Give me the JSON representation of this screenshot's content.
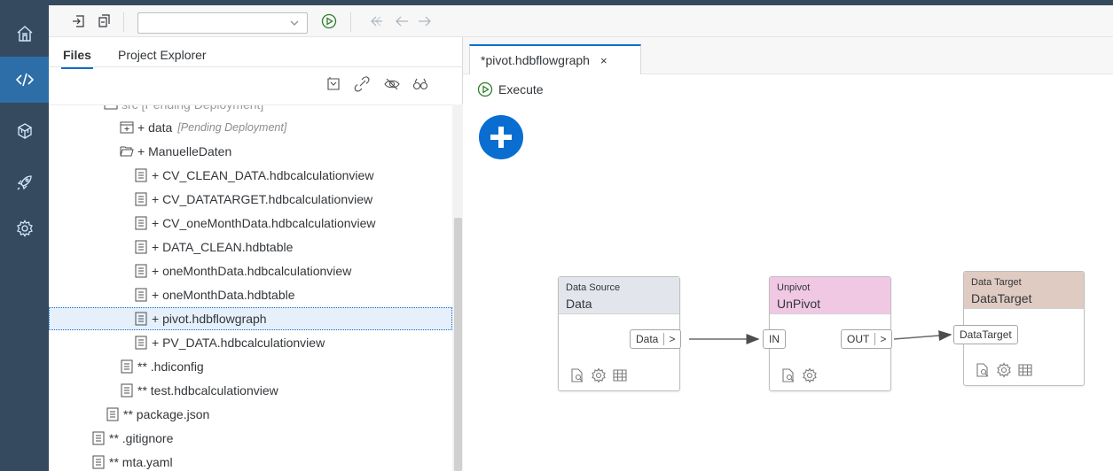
{
  "colors": {
    "rail_bg": "#354a5f",
    "accent": "#0a6ed1",
    "source_header": "#e2e6ec",
    "unpivot_header": "#f0c8e4",
    "target_header": "#e0cbc2"
  },
  "rail": {
    "items": [
      {
        "name": "home-icon",
        "active": false
      },
      {
        "name": "code-icon",
        "active": true
      },
      {
        "name": "package-icon",
        "active": false
      },
      {
        "name": "rocket-icon",
        "active": false
      },
      {
        "name": "settings-icon",
        "active": false
      }
    ]
  },
  "toolbar": {
    "run_config_selected": ""
  },
  "files_panel": {
    "tabs": [
      {
        "label": "Files",
        "active": true
      },
      {
        "label": "Project Explorer",
        "active": false
      }
    ]
  },
  "tree": {
    "rows": [
      {
        "label": "src  [Pending Deployment]",
        "type": "folder",
        "indent": 1
      },
      {
        "label": "+ data",
        "pending": "[Pending Deployment]",
        "type": "folder-add",
        "indent": 2
      },
      {
        "label": "+ ManuelleDaten",
        "type": "folder-open",
        "indent": 2
      },
      {
        "label": "+ CV_CLEAN_DATA.hdbcalculationview",
        "type": "file",
        "indent": 3
      },
      {
        "label": "+ CV_DATATARGET.hdbcalculationview",
        "type": "file",
        "indent": 3
      },
      {
        "label": "+ CV_oneMonthData.hdbcalculationview",
        "type": "file",
        "indent": 3
      },
      {
        "label": "+ DATA_CLEAN.hdbtable",
        "type": "file",
        "indent": 3
      },
      {
        "label": "+ oneMonthData.hdbcalculationview",
        "type": "file",
        "indent": 3
      },
      {
        "label": "+ oneMonthData.hdbtable",
        "type": "file",
        "indent": 3
      },
      {
        "label": "+ pivot.hdbflowgraph",
        "type": "file",
        "indent": 3,
        "selected": true
      },
      {
        "label": "+ PV_DATA.hdbcalculationview",
        "type": "file",
        "indent": 3
      },
      {
        "label": "** .hdiconfig",
        "type": "file",
        "indent": 2
      },
      {
        "label": "** test.hdbcalculationview",
        "type": "file",
        "indent": 2
      },
      {
        "label": "** package.json",
        "type": "file",
        "indent": 1
      },
      {
        "label": "** .gitignore",
        "type": "file",
        "indent": 0
      },
      {
        "label": "** mta.yaml",
        "type": "file",
        "indent": 0
      }
    ]
  },
  "editor": {
    "tab_label": "*pivot.hdbflowgraph",
    "close_label": "×",
    "execute_label": "Execute"
  },
  "flowgraph": {
    "nodes": [
      {
        "type": "Data Source",
        "name": "Data",
        "port_out": "Data",
        "icons": [
          "search-doc-icon",
          "settings-icon",
          "table-icon"
        ]
      },
      {
        "type": "Unpivot",
        "name": "UnPivot",
        "port_in": "IN",
        "port_out": "OUT",
        "icons": [
          "search-doc-icon",
          "settings-icon"
        ]
      },
      {
        "type": "Data Target",
        "name": "DataTarget",
        "port_in": "DataTarget",
        "icons": [
          "search-doc-icon",
          "settings-icon",
          "table-icon"
        ]
      }
    ]
  }
}
